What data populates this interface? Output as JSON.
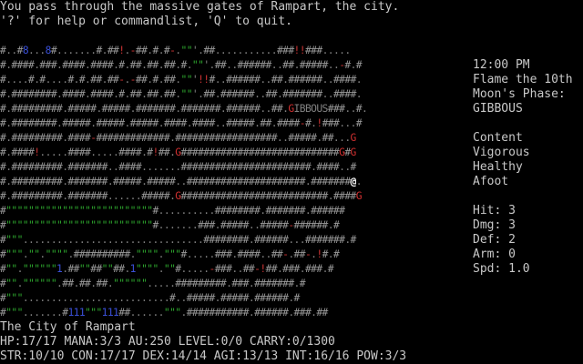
{
  "messages": [
    "You pass through the massive gates of Rampart, the city.",
    "'?' for help or commandlist, 'Q' to quit."
  ],
  "map_rows": [
    "#..#8...8#.......#.##!.-##.#.#-.\"\"'.##...........###!!###.....",
    "#.####.###.####.####.#.##.##.##.#.\"\"'.##..######..##.#####..-#.#",
    "#....#.#....#.#.##.##-.-##.#.##.\"\"'!!#..######..##.######..####.",
    "#.########.####.####.#.##.##.##.\"\"'.##.######..##.#######..####.",
    "#.#########.#####.#####.#######.#######.######..##.GIBBOUS###..#.",
    "#.########.#####.#####.#####.####.####..#####.##.####-#.!###...#",
    "#.#########.####-#############.##################..#####.##...G",
    "#.####!.....####.....####.#!##.G############################G#G",
    "#.#########.#######..####.......#######################.####..#",
    "#.#########.#######.#####.#####..#####################.#######@.",
    "#.#########.#######......#####.G##########################.####G",
    "#\"\"\"\"\"\"\"\"\"\"\"\"\"\"\"\"\"\"\"\"\"\"\"\"\"\"#..........########.#######.######",
    "#\"\"\"\"\"\"\"\"\"\"\"\"\"\"\"\"\"\"\"\"\"\"\"\"\"\"#.......###.#####..#####-######.#",
    "#\"\"\"................................########.######...#######.#",
    "#\"\"\".\"\".\"\"\"\".##########.\"\"\"\".\"\"\"#.....###.####..##-.##-.!#.#",
    "#\"\".\"\"\"\"\"\"1.##\"\"##\"\"##.1\"\"\"\".\"\"#.....-###..##-!##.###.###.#",
    "#\"\".\"\"\"\"\"\".##.##.##.\"\"\"\"\"\".....#########.###.#######.#",
    "#\"\"\"..........................#..#####.#####.######.#",
    "#\"\"\".......#111\"\"\"111##......\"\"\".###########.######.###.##"
  ],
  "sidebar": {
    "time": "12:00 PM",
    "date": "Flame the 10th",
    "moon_label": "Moon's Phase:",
    "moon_phase": "GIBBOUS",
    "status1": "Content",
    "status2": "Vigorous",
    "status3": "Healthy",
    "status4": "Afoot",
    "hit": "Hit: 3",
    "dmg": "Dmg: 3",
    "def": "Def: 2",
    "arm": "Arm: 0",
    "spd": "Spd: 1.0"
  },
  "location": "The City of Rampart",
  "stats_line1": "HP:17/17 MANA:3/3 AU:250 LEVEL:0/0 CARRY:0/1300",
  "stats_line2": "STR:10/10 CON:17/17 DEX:14/14 AGI:13/13 INT:16/16 POW:3/3",
  "colors": {
    "wall": "#9a9a9a",
    "door": "#c83232",
    "grass": "#2ea82e",
    "water": "#3a50d8",
    "player": "#ffffff",
    "guard": "#d03030"
  }
}
